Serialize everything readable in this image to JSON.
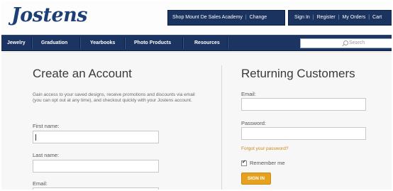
{
  "header": {
    "logo": "Jostens",
    "school_label": "Shop Mount De Sales Academy",
    "change_label": "Change",
    "account_links": [
      "Sign In",
      "Register",
      "My Orders",
      "Cart"
    ]
  },
  "nav": {
    "items": [
      "Jewelry",
      "Graduation",
      "Yearbooks",
      "Photo Products",
      "Resources"
    ],
    "search_placeholder": "Search"
  },
  "create_account": {
    "title": "Create an Account",
    "description": "Gain access to your saved designs, receive promotions and discounts via email (you can opt out at any time), and checkout quickly with your Jostens account.",
    "first_name_label": "First name:",
    "last_name_label": "Last name:",
    "email_label": "Email:"
  },
  "returning": {
    "title": "Returning Customers",
    "email_label": "Email:",
    "password_label": "Password:",
    "forgot_label": "Forgot your password?",
    "remember_label": "Remember me",
    "remember_checked": true,
    "signin_label": "SIGN IN"
  },
  "colors": {
    "nav_bg": "#1c3462",
    "brand_blue": "#1d3f78",
    "accent_gold": "#e6a21e"
  }
}
